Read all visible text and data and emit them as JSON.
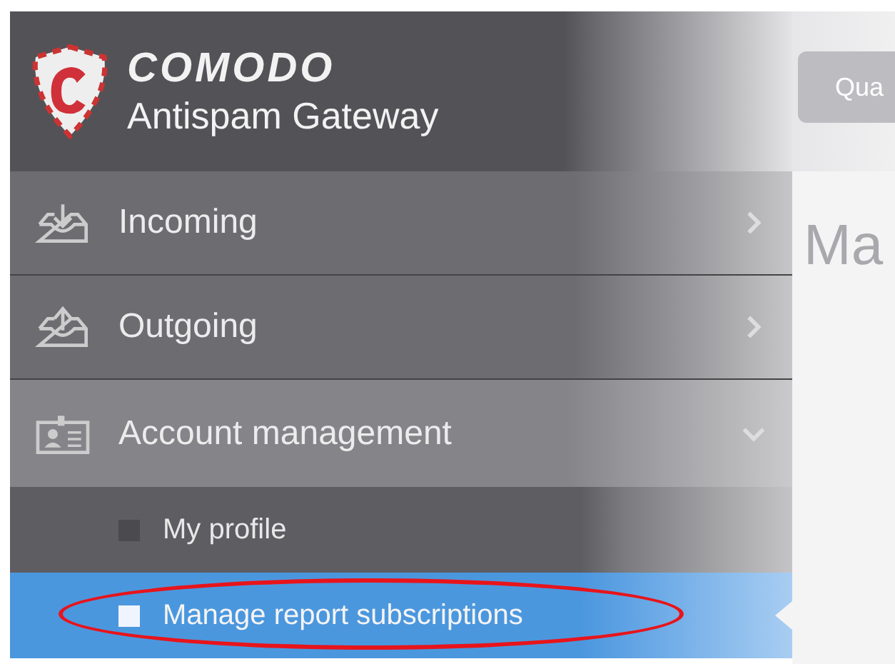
{
  "brand": {
    "name": "COMODO",
    "product": "Antispam Gateway"
  },
  "top_bar": {
    "button": "Qua"
  },
  "page": {
    "heading": "Ma"
  },
  "menu": [
    {
      "label": "Incoming",
      "kind": "inbox-in",
      "expanded": false
    },
    {
      "label": "Outgoing",
      "kind": "inbox-out",
      "expanded": false
    },
    {
      "label": "Account management",
      "kind": "account",
      "expanded": true,
      "children": [
        {
          "label": "My profile",
          "selected": false
        },
        {
          "label": "Manage report subscriptions",
          "selected": true,
          "highlighted": true
        }
      ]
    }
  ]
}
